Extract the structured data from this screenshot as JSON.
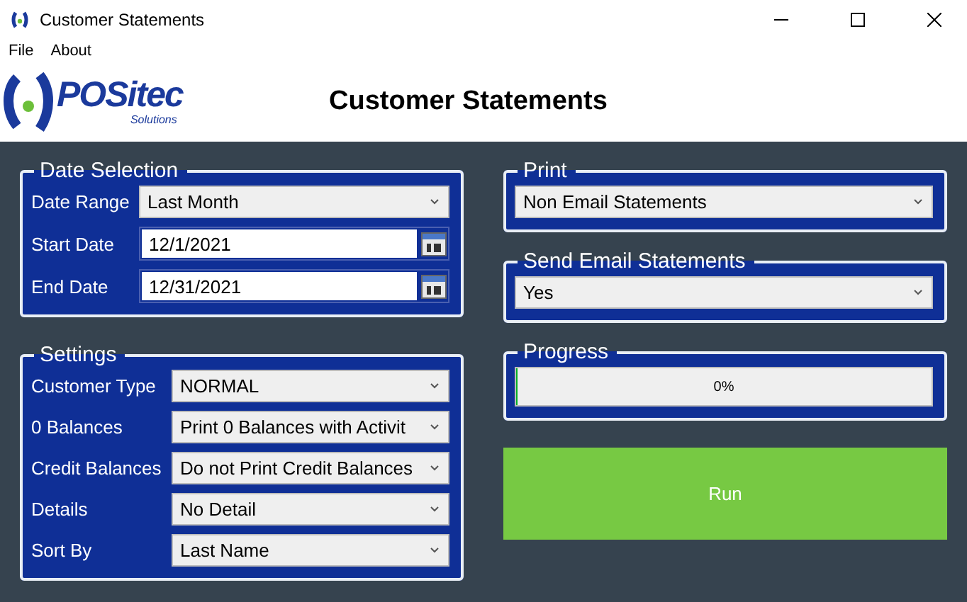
{
  "window": {
    "title": "Customer Statements"
  },
  "menu": [
    "File",
    "About"
  ],
  "logo": {
    "brand": "POSitec",
    "tagline": "Solutions"
  },
  "header": {
    "title": "Customer Statements"
  },
  "date_selection": {
    "title": "Date Selection",
    "fields": [
      {
        "kind": "dropdown",
        "label": "Date Range",
        "value": "Last Month"
      },
      {
        "kind": "date",
        "label": "Start Date",
        "value": "12/1/2021"
      },
      {
        "kind": "date",
        "label": "End Date",
        "value": "12/31/2021"
      }
    ]
  },
  "settings": {
    "title": "Settings",
    "fields": [
      {
        "kind": "dropdown",
        "label": "Customer Type",
        "value": "NORMAL"
      },
      {
        "kind": "dropdown",
        "label": "0 Balances",
        "value": "Print 0 Balances with Activit"
      },
      {
        "kind": "dropdown",
        "label": "Credit Balances",
        "value": "Do not Print Credit Balances"
      },
      {
        "kind": "dropdown",
        "label": "Details",
        "value": "No Detail"
      },
      {
        "kind": "dropdown",
        "label": "Sort By",
        "value": "Last Name"
      }
    ]
  },
  "print": {
    "title": "Print",
    "value": "Non Email Statements"
  },
  "send_email": {
    "title": "Send Email Statements",
    "value": "Yes"
  },
  "progress": {
    "title": "Progress",
    "level": 0,
    "reading": "0%"
  },
  "run_button": {
    "label": "Run"
  }
}
